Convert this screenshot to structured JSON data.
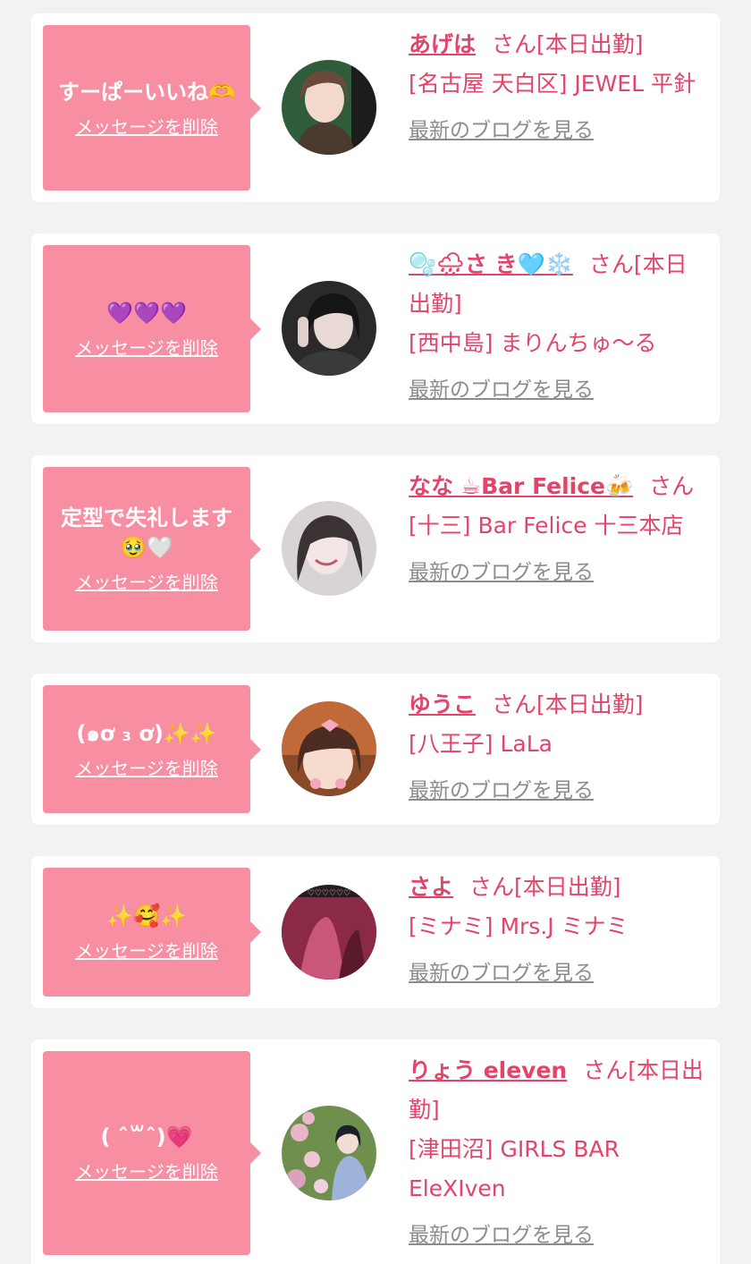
{
  "delete_label": "メッセージを削除",
  "blog_label": "最新のブログを見る",
  "san_suffix": "さん",
  "shift_label": "[本日出勤]",
  "accent_color": "#e2446a",
  "bubble_color": "#f78ea2",
  "cards": [
    {
      "message": "すーぱーいいね🫶",
      "name": "あげは",
      "shop": "[名古屋 天白区] JEWEL 平針",
      "on_shift": true
    },
    {
      "message": "💜💜💜",
      "name": "🫧🌧さ き🩵❄️",
      "shop": "[西中島] まりんちゅ〜る",
      "on_shift": true
    },
    {
      "message": "定型で失礼します🥹🤍",
      "name": "なな ☕Bar Felice🍻",
      "shop": "[十三] Bar Felice 十三本店",
      "on_shift": false
    },
    {
      "message": "(๑ơ ₃ ơ)✨✨",
      "name": "ゆうこ",
      "shop": "[八王子] LaLa",
      "on_shift": true
    },
    {
      "message": "✨🥰✨",
      "name": "さよ",
      "shop": "[ミナミ] Mrs.J ミナミ",
      "on_shift": true
    },
    {
      "message": "( ˆ꒳ˆ)💗",
      "name": "りょう eleven",
      "shop": "[津田沼] GIRLS BAR EleXIven",
      "on_shift": true
    }
  ]
}
